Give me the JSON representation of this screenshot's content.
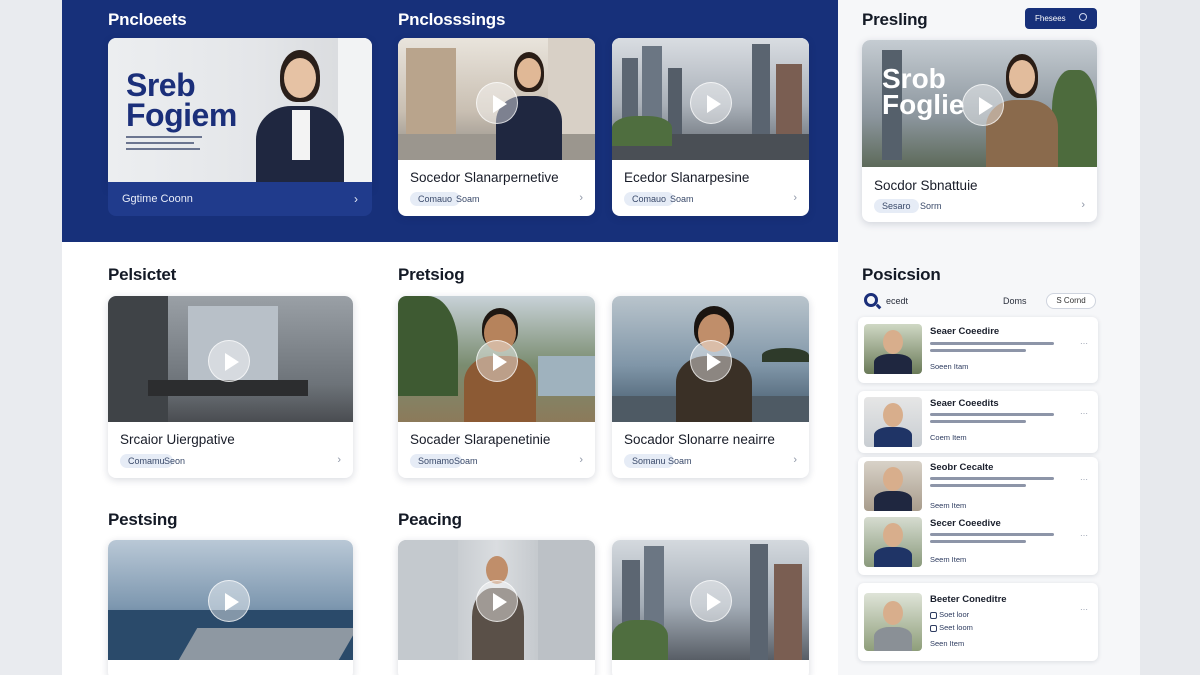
{
  "hero": {
    "sections": [
      "Pncloeets",
      "Pnclosssings",
      "Presling"
    ],
    "feature": {
      "headline_1": "Sreb",
      "headline_2": "Fogiem",
      "footer": "Ggtime Coonn"
    },
    "cards": [
      {
        "title": "Socedor Slanarpernetive",
        "chip": "Comauo",
        "meta": "Soam"
      },
      {
        "title": "Ecedor Slanarpesine",
        "chip": "Comauo",
        "meta": "Soam"
      }
    ],
    "side_feature": {
      "headline_1": "Srob",
      "headline_2": "Foglie",
      "title": "Socdor Sbnattuie",
      "chip": "Sesaro",
      "meta": "Sorm"
    },
    "top_button": "Fhesees"
  },
  "row2": {
    "sections": [
      "Pelsictet",
      "Pretsiog"
    ],
    "cards": [
      {
        "title": "Srcaior Uiergpative",
        "chip": "Comamu",
        "meta": "Seon"
      },
      {
        "title": "Socader Slarapenetinie",
        "chip": "Somamo",
        "meta": "Soam"
      },
      {
        "title": "Socador Slonarre neairre",
        "chip": "Somanu",
        "meta": "Soam"
      }
    ]
  },
  "row3": {
    "sections": [
      "Pestsing",
      "Peacing"
    ],
    "cards": [
      {
        "title": ""
      },
      {
        "title": ""
      },
      {
        "title": ""
      }
    ]
  },
  "side": {
    "title": "Posicsion",
    "search_label": "ecedt",
    "dropdown": "Doms",
    "filter": "S Cornd",
    "items": [
      {
        "title": "Seaer Coeedire",
        "meta": "Soeen Itam"
      },
      {
        "title": "Seaer Coeedits",
        "meta": "Coem Item"
      },
      {
        "title": "Seobr Cecalte",
        "meta": "Seem Item"
      },
      {
        "title": "Secer Coeedive",
        "meta": "Seem Item"
      },
      {
        "title": "Beeter Coneditre",
        "meta": "Seen Item",
        "sub_1": "Soet loor",
        "sub_2": "Seet loom"
      }
    ]
  }
}
